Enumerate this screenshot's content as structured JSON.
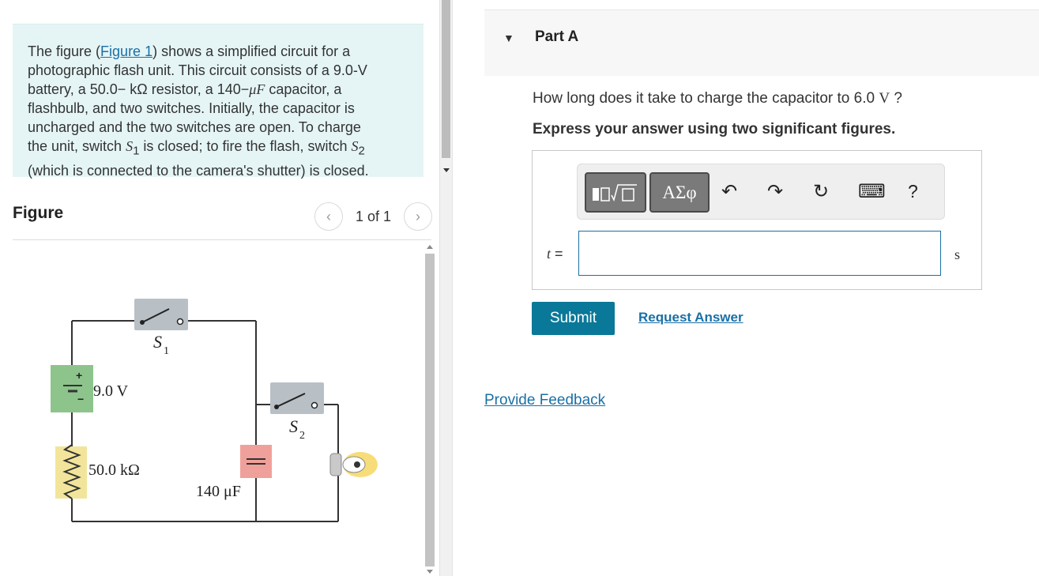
{
  "intro": {
    "text_before_link": "The figure (",
    "link_text": "Figure 1",
    "line1_after": ") shows a simplified circuit for a",
    "line2": "photographic flash unit. This circuit consists of a 9.0-V",
    "line3_a": "battery, a 50.0− kΩ resistor, a 140−",
    "line3_b": "μF",
    "line3_c": " capacitor, a",
    "line4": "flashbulb, and two switches. Initially, the capacitor is",
    "line5": "uncharged and the two switches are open. To charge",
    "line6_a": "the unit, switch ",
    "s1": "S",
    "s1_sub": "1",
    "line6_b": " is closed; to fire the flash, switch ",
    "s2": "S",
    "s2_sub": "2",
    "line7": "(which is connected to the camera's shutter) is closed."
  },
  "figure": {
    "title": "Figure",
    "pager_text": "1 of 1",
    "prev_icon": "chevron-left-icon",
    "next_icon": "chevron-right-icon",
    "labels": {
      "switch1_letter": "S",
      "switch1_sub": "1",
      "switch2_letter": "S",
      "switch2_sub": "2",
      "battery": "9.0 V",
      "resistor": "50.0 kΩ",
      "capacitor": "140 μF",
      "plus": "+",
      "minus": "−"
    },
    "colors": {
      "switch_fill": "#b8c0c6",
      "battery_fill": "#8dc48c",
      "resistor_fill": "#f2e59b",
      "capacitor_fill": "#f0a09a",
      "bulb_fill": "#f7dd7a"
    }
  },
  "part": {
    "caret_icon": "caret-down-icon",
    "caret": "▼",
    "title": "Part A",
    "question_a": "How long does it take to charge the capacitor to 6.0 ",
    "question_unit": "V",
    "question_b": " ?",
    "instruction": "Express your answer using two significant figures."
  },
  "toolbar": {
    "templates_icon": "templates-icon",
    "greek_label": "ΑΣφ",
    "undo_glyph": "↶",
    "redo_glyph": "↷",
    "reset_glyph": "↻",
    "keyboard_glyph": "⌨",
    "help_label": "?"
  },
  "answer": {
    "variable": "t",
    "equals": " =",
    "value": "",
    "unit": "s"
  },
  "actions": {
    "submit_label": "Submit",
    "request_label": "Request Answer",
    "feedback_label": "Provide Feedback"
  },
  "colors": {
    "intro_bg": "#e5f5f6",
    "link": "#1a70a6",
    "submit_bg": "#0a7898"
  }
}
